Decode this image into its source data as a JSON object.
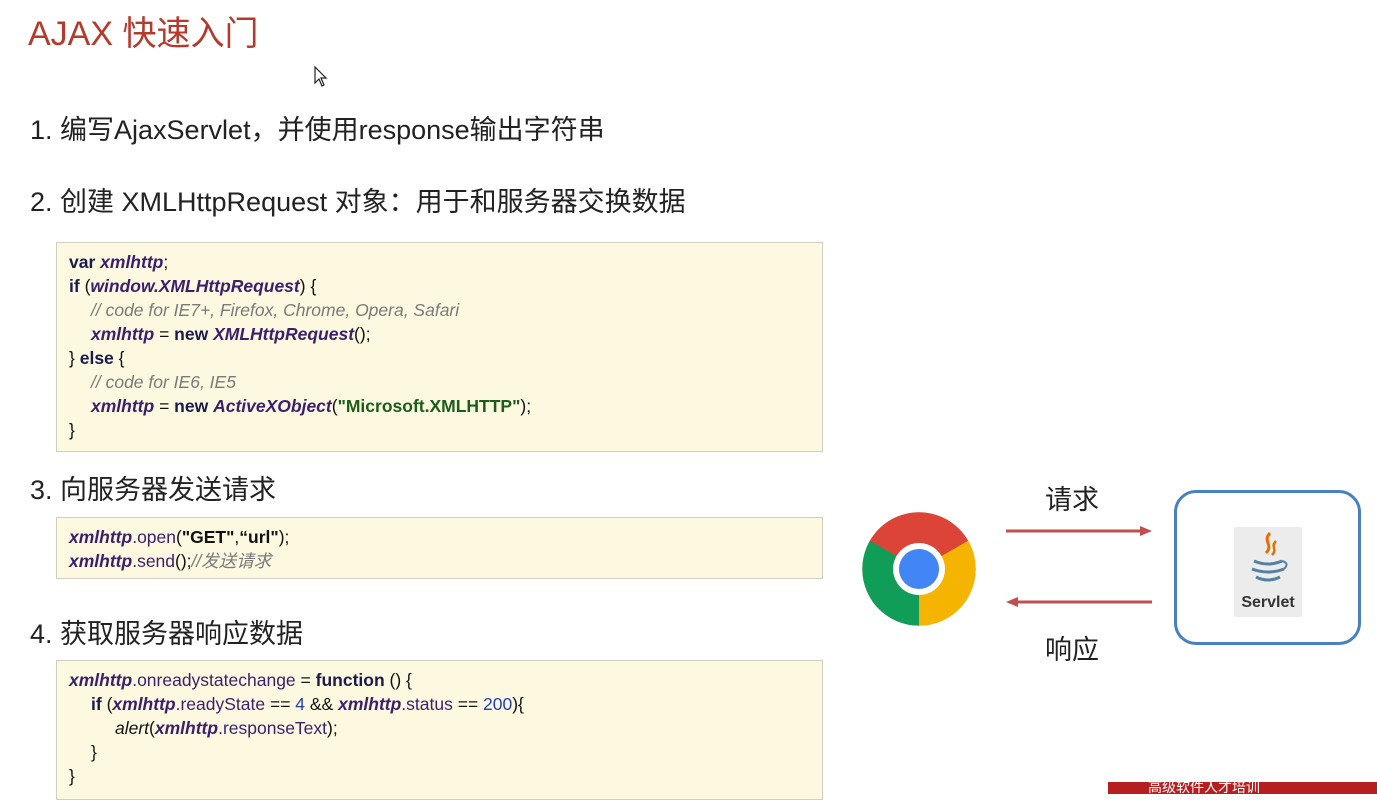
{
  "title": "AJAX 快速入门",
  "steps": {
    "s1": "1. 编写AjaxServlet，并使用response输出字符串",
    "s2": "2. 创建 XMLHttpRequest 对象：用于和服务器交换数据",
    "s3": "3. 向服务器发送请求",
    "s4": "4. 获取服务器响应数据"
  },
  "code2": {
    "l1_kw": "var",
    "l1_var": "xmlhttp",
    "l1_end": ";",
    "l2_kw": "if",
    "l2_open": " (",
    "l2_obj": "window.XMLHttpRequest",
    "l2_end": ") {",
    "l3_cm": "// code for IE7+, Firefox, Chrome, Opera, Safari",
    "l4_var": "xmlhttp",
    "l4_eq": " = ",
    "l4_kw": "new",
    "l4_obj": "XMLHttpRequest",
    "l4_end": "();",
    "l5_a": "} ",
    "l5_kw": "else",
    "l5_b": " {",
    "l6_cm": "// code for IE6, IE5",
    "l7_var": "xmlhttp",
    "l7_eq": " = ",
    "l7_kw": "new",
    "l7_obj": "ActiveXObject",
    "l7_p1": "(",
    "l7_str": "\"Microsoft.XMLHTTP\"",
    "l7_end": ");",
    "l8": "}"
  },
  "code3": {
    "l1_var": "xmlhttp",
    "l1_meth": ".open",
    "l1_p": "(",
    "l1_s1": "\"GET\"",
    "l1_c": ",",
    "l1_s2": "“url\"",
    "l1_end": ");",
    "l2_var": "xmlhttp",
    "l2_meth": ".send",
    "l2_p": "();",
    "l2_cm": "//发送请求"
  },
  "code4": {
    "l1_var": "xmlhttp",
    "l1_meth": ".onreadystatechange",
    "l1_eq": " = ",
    "l1_kw": "function",
    "l1_end": " () {",
    "l2_kw": "if",
    "l2_p": " (",
    "l2_var1": "xmlhttp",
    "l2_m1": ".readyState",
    "l2_eq": " == ",
    "l2_n1": "4",
    "l2_and": " && ",
    "l2_var2": "xmlhttp",
    "l2_m2": ".status",
    "l2_eq2": " == ",
    "l2_n2": "200",
    "l2_end": "){",
    "l3_fn": "alert",
    "l3_p": "(",
    "l3_var": "xmlhttp",
    "l3_m": ".responseText",
    "l3_end": ");",
    "l4": "}",
    "l5": "}"
  },
  "diagram": {
    "request_label": "请求",
    "response_label": "响应",
    "browser_icon": "chrome-icon",
    "server_icon": "java-icon",
    "server_label": "Servlet",
    "arrow_color": "#c0504d",
    "server_border_color": "#4a7fc0"
  },
  "banner_text": "高级软件人才培训"
}
